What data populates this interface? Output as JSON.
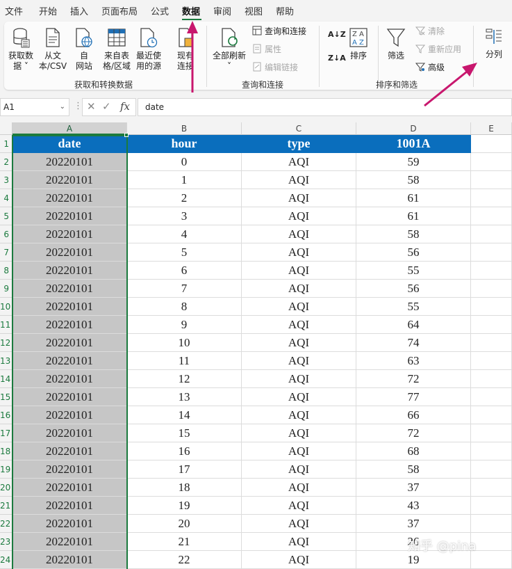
{
  "menu": [
    {
      "label": "文件"
    },
    {
      "label": "开始"
    },
    {
      "label": "插入"
    },
    {
      "label": "页面布局"
    },
    {
      "label": "公式"
    },
    {
      "label": "数据"
    },
    {
      "label": "审阅"
    },
    {
      "label": "视图"
    },
    {
      "label": "帮助"
    }
  ],
  "active_menu": "数据",
  "ribbon": {
    "get_data": {
      "line1": "获取数",
      "line2": "据 ˅"
    },
    "from_csv": {
      "line1": "从文",
      "line2": "本/CSV"
    },
    "from_web": {
      "line1": "自",
      "line2": "网站"
    },
    "from_table": {
      "line1": "来自表",
      "line2": "格/区域"
    },
    "recent_sources": {
      "line1": "最近使",
      "line2": "用的源"
    },
    "existing_conn": {
      "line1": "现有",
      "line2": "连接"
    },
    "refresh_all": {
      "line1": "全部刷新",
      "line2": "˅"
    },
    "queries_conn": "查询和连接",
    "properties": "属性",
    "edit_links": "编辑链接",
    "sort_az": "A→Z",
    "sort_za": "Z→A",
    "sort": "排序",
    "filter": "筛选",
    "clear": "清除",
    "reapply": "重新应用",
    "advanced": "高级",
    "text_to_columns": "分列",
    "group_get_transform": "获取和转换数据",
    "group_queries": "查询和连接",
    "group_sort_filter": "排序和筛选"
  },
  "formula_bar": {
    "name_box": "A1",
    "fx": "fx",
    "formula": "date"
  },
  "columns": [
    "A",
    "B",
    "C",
    "D",
    "E"
  ],
  "header_row": [
    "date",
    "hour",
    "type",
    "1001A"
  ],
  "rows": [
    [
      "20220101",
      "0",
      "AQI",
      "59"
    ],
    [
      "20220101",
      "1",
      "AQI",
      "58"
    ],
    [
      "20220101",
      "2",
      "AQI",
      "61"
    ],
    [
      "20220101",
      "3",
      "AQI",
      "61"
    ],
    [
      "20220101",
      "4",
      "AQI",
      "58"
    ],
    [
      "20220101",
      "5",
      "AQI",
      "56"
    ],
    [
      "20220101",
      "6",
      "AQI",
      "55"
    ],
    [
      "20220101",
      "7",
      "AQI",
      "56"
    ],
    [
      "20220101",
      "8",
      "AQI",
      "55"
    ],
    [
      "20220101",
      "9",
      "AQI",
      "64"
    ],
    [
      "20220101",
      "10",
      "AQI",
      "74"
    ],
    [
      "20220101",
      "11",
      "AQI",
      "63"
    ],
    [
      "20220101",
      "12",
      "AQI",
      "72"
    ],
    [
      "20220101",
      "13",
      "AQI",
      "77"
    ],
    [
      "20220101",
      "14",
      "AQI",
      "66"
    ],
    [
      "20220101",
      "15",
      "AQI",
      "72"
    ],
    [
      "20220101",
      "16",
      "AQI",
      "68"
    ],
    [
      "20220101",
      "17",
      "AQI",
      "58"
    ],
    [
      "20220101",
      "18",
      "AQI",
      "37"
    ],
    [
      "20220101",
      "19",
      "AQI",
      "43"
    ],
    [
      "20220101",
      "20",
      "AQI",
      "37"
    ],
    [
      "20220101",
      "21",
      "AQI",
      "26"
    ],
    [
      "20220101",
      "22",
      "AQI",
      "19"
    ]
  ],
  "row_numbers": [
    "1",
    "2",
    "3",
    "4",
    "5",
    "6",
    "7",
    "8",
    "9",
    "10",
    "11",
    "12",
    "13",
    "14",
    "15",
    "16",
    "17",
    "18",
    "19",
    "20",
    "21",
    "22",
    "23",
    "24"
  ],
  "watermark": "知乎 @pina",
  "colors": {
    "header_fill": "#0a6ebd",
    "selected_column": "#c6c6c6",
    "excel_green": "#1b7a3e",
    "arrow": "#c8176e"
  }
}
